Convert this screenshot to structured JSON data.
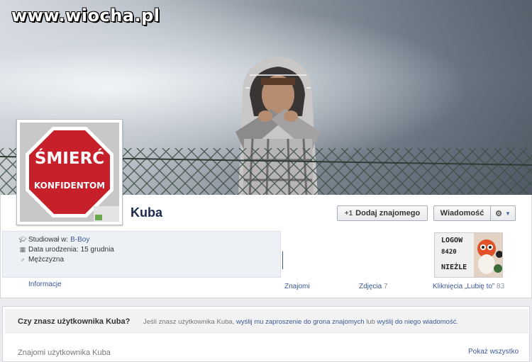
{
  "watermark": "www.wiocha.pl",
  "profile": {
    "name": "Kuba",
    "picture_line1": "ŚMIERĆ",
    "picture_line2": "KONFIDENTOM"
  },
  "actions": {
    "add_friend": "Dodaj znajomego",
    "message": "Wiadomość",
    "gear_icon": "gear-icon",
    "add_friend_icon": "add-friend-icon"
  },
  "info": {
    "studied_label": "Studiował w:",
    "studied_value": "B-Boy",
    "birth_label": "Data urodzenia:",
    "birth_value": "15 grudnia",
    "gender": "Mężczyzna",
    "info_link": "Informacje"
  },
  "nav": {
    "friends": "Znajomi",
    "photos": "Zdjęcia",
    "photos_count": "7",
    "likes": "Kliknięcia „Lubię to”",
    "likes_count": "83"
  },
  "thumb": {
    "line1": "LOGOW",
    "line2": "8420",
    "line3": "NIEŻLE"
  },
  "know": {
    "question": "Czy znasz użytkownika Kuba?",
    "prefix": "Jeśli znasz użytkownika Kuba,",
    "invite_link": "wyślij mu zaproszenie do grona znajomych",
    "or": "lub",
    "message_link": "wyślij do niego wiadomość",
    "suffix": "."
  },
  "friends_section": {
    "heading": "Znajomi użytkownika Kuba",
    "show_all": "Pokaż wszystko"
  },
  "colors": {
    "link": "#3b5998",
    "stop_red": "#c8202b",
    "name": "#1c2b4a"
  }
}
